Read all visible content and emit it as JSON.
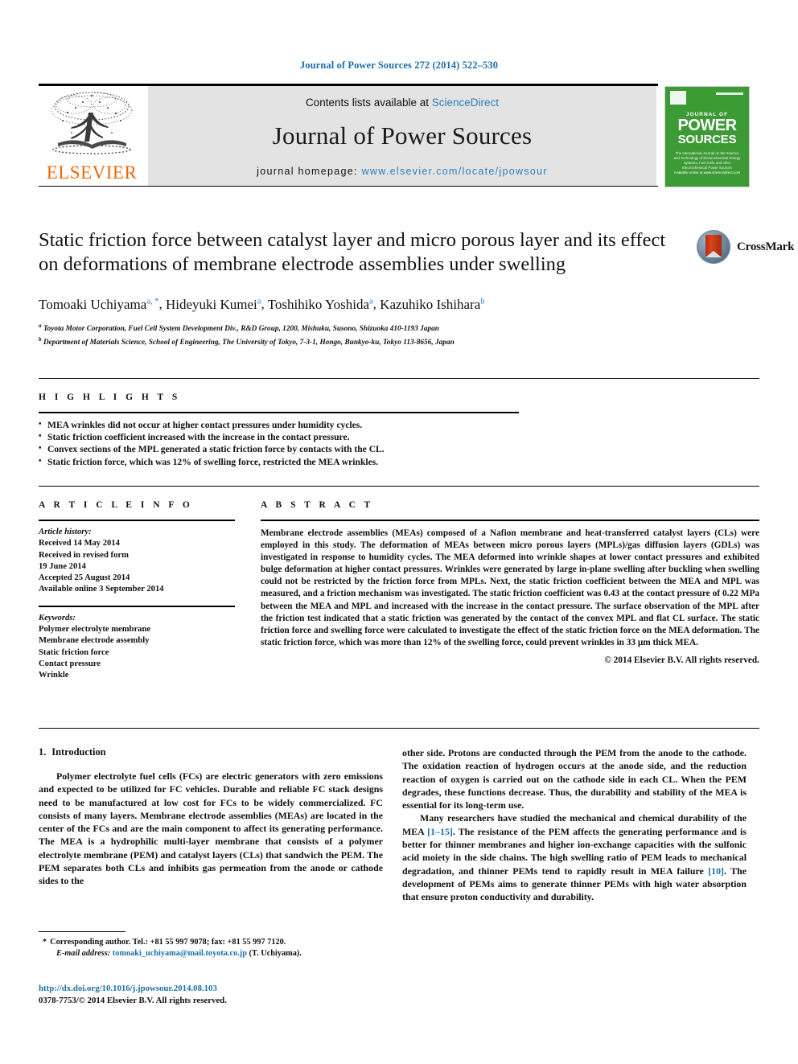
{
  "running_head": "Journal of Power Sources 272 (2014) 522–530",
  "header": {
    "contents_prefix": "Contents lists available at ",
    "sciencedirect": "ScienceDirect",
    "journal_title": "Journal of Power Sources",
    "homepage_prefix": "journal homepage: ",
    "homepage_url": "www.elsevier.com/locate/jpowsour",
    "publisher_wordmark": "ELSEVIER",
    "cover": {
      "journal_of": "JOURNAL OF",
      "power": "POWER",
      "sources": "SOURCES",
      "subtitle": "The International Journal on the Science and Technology of Electrochemical Energy Systems, Fuel Cells and other Electrochemical Power Sources",
      "footer": "Available online at www.sciencedirect.com"
    },
    "accent_blue": "#2e7ebb",
    "elsevier_orange": "#eb6a09",
    "cover_green": "#3d9b35"
  },
  "article": {
    "title": "Static friction force between catalyst layer and micro porous layer and its effect on deformations of membrane electrode assemblies under swelling",
    "crossmark_label": "CrossMark",
    "authors": [
      {
        "name": "Tomoaki Uchiyama",
        "marks": "a, *"
      },
      {
        "name": "Hideyuki Kumei",
        "marks": "a"
      },
      {
        "name": "Toshihiko Yoshida",
        "marks": "a"
      },
      {
        "name": "Kazuhiko Ishihara",
        "marks": "b"
      }
    ],
    "affiliations": [
      {
        "mark": "a",
        "text": "Toyota Motor Corporation, Fuel Cell System Development Div., R&D Group, 1200, Mishuku, Susono, Shizuoka 410-1193 Japan"
      },
      {
        "mark": "b",
        "text": "Department of Materials Science, School of Engineering, The University of Tokyo, 7-3-1, Hongo, Bunkyo-ku, Tokyo 113-8656, Japan"
      }
    ]
  },
  "highlights": {
    "label": "H I G H L I G H T S",
    "items": [
      "MEA wrinkles did not occur at higher contact pressures under humidity cycles.",
      "Static friction coefficient increased with the increase in the contact pressure.",
      "Convex sections of the MPL generated a static friction force by contacts with the CL.",
      "Static friction force, which was 12% of swelling force, restricted the MEA wrinkles."
    ]
  },
  "article_info": {
    "label": "A R T I C L E   I N F O",
    "history_label": "Article history:",
    "history": [
      "Received 14 May 2014",
      "Received in revised form",
      "19 June 2014",
      "Accepted 25 August 2014",
      "Available online 3 September 2014"
    ],
    "keywords_label": "Keywords:",
    "keywords": [
      "Polymer electrolyte membrane",
      "Membrane electrode assembly",
      "Static friction force",
      "Contact pressure",
      "Wrinkle"
    ]
  },
  "abstract": {
    "label": "A B S T R A C T",
    "text": "Membrane electrode assemblies (MEAs) composed of a Nafion membrane and heat-transferred catalyst layers (CLs) were employed in this study. The deformation of MEAs between micro porous layers (MPLs)/gas diffusion layers (GDLs) was investigated in response to humidity cycles. The MEA deformed into wrinkle shapes at lower contact pressures and exhibited bulge deformation at higher contact pressures. Wrinkles were generated by large in-plane swelling after buckling when swelling could not be restricted by the friction force from MPLs. Next, the static friction coefficient between the MEA and MPL was measured, and a friction mechanism was investigated. The static friction coefficient was 0.43 at the contact pressure of 0.22 MPa between the MEA and MPL and increased with the increase in the contact pressure. The surface observation of the MPL after the friction test indicated that a static friction was generated by the contact of the convex MPL and flat CL surface. The static friction force and swelling force were calculated to investigate the effect of the static friction force on the MEA deformation. The static friction force, which was more than 12% of the swelling force, could prevent wrinkles in 33 μm thick MEA.",
    "copyright": "© 2014 Elsevier B.V. All rights reserved."
  },
  "body": {
    "section_number": "1.",
    "section_title": "Introduction",
    "left_paragraph": "Polymer electrolyte fuel cells (FCs) are electric generators with zero emissions and expected to be utilized for FC vehicles. Durable and reliable FC stack designs need to be manufactured at low cost for FCs to be widely commercialized. FC consists of many layers. Membrane electrode assemblies (MEAs) are located in the center of the FCs and are the main component to affect its generating performance. The MEA is a hydrophilic multi-layer membrane that consists of a polymer electrolyte membrane (PEM) and catalyst layers (CLs) that sandwich the PEM. The PEM separates both CLs and inhibits gas permeation from the anode or cathode sides to the",
    "right_paragraph_1": "other side. Protons are conducted through the PEM from the anode to the cathode. The oxidation reaction of hydrogen occurs at the anode side, and the reduction reaction of oxygen is carried out on the cathode side in each CL. When the PEM degrades, these functions decrease. Thus, the durability and stability of the MEA is essential for its long-term use.",
    "right_paragraph_2_a": "Many researchers have studied the mechanical and chemical durability of the MEA ",
    "right_ref_1": "[1–15]",
    "right_paragraph_2_b": ". The resistance of the PEM affects the generating performance and is better for thinner membranes and higher ion-exchange capacities with the sulfonic acid moiety in the side chains. The high swelling ratio of PEM leads to mechanical degradation, and thinner PEMs tend to rapidly result in MEA failure ",
    "right_ref_2": "[10]",
    "right_paragraph_2_c": ". The development of PEMs aims to generate thinner PEMs with high water absorption that ensure proton conductivity and durability."
  },
  "footer": {
    "corresponding_star": "*",
    "corresponding_text": "Corresponding author. Tel.: +81 55 997 9078; fax: +81 55 997 7120.",
    "email_label": "E-mail address:",
    "email": "tomoaki_uchiyama@mail.toyota.co.jp",
    "email_suffix": "(T. Uchiyama).",
    "doi_url": "http://dx.doi.org/10.1016/j.jpowsour.2014.08.103",
    "issn_line": "0378-7753/© 2014 Elsevier B.V. All rights reserved."
  }
}
